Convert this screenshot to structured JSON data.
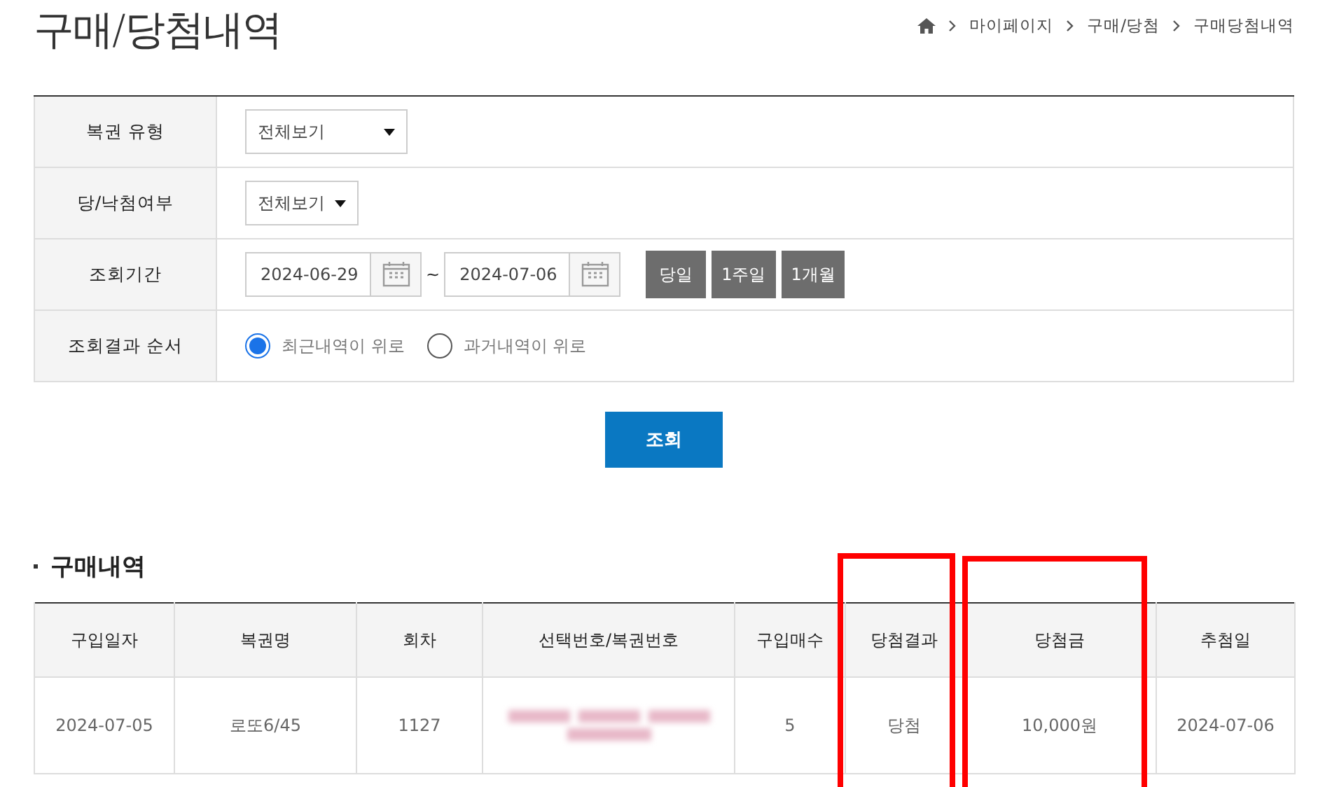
{
  "page_title": "구매/당첨내역",
  "breadcrumb": [
    "마이페이지",
    "구매/당첨",
    "구매당첨내역"
  ],
  "search_form": {
    "rows": [
      {
        "kind": "select",
        "label": "복권 유형",
        "value": "전체보기",
        "wide": true
      },
      {
        "kind": "select",
        "label": "당/낙첨여부",
        "value": "전체보기",
        "wide": false
      },
      {
        "kind": "period",
        "label": "조회기간",
        "from": "2024-06-29",
        "separator": "~",
        "to": "2024-07-06",
        "buttons": [
          "당일",
          "1주일",
          "1개월"
        ]
      },
      {
        "kind": "radio",
        "label": "조회결과 순서",
        "options": [
          {
            "label": "최근내역이 위로",
            "selected": true
          },
          {
            "label": "과거내역이 위로",
            "selected": false
          }
        ]
      }
    ]
  },
  "search_button": "조회",
  "section_title": "구매내역",
  "table": {
    "columns": [
      "구입일자",
      "복권명",
      "회차",
      "선택번호/복권번호",
      "구입매수",
      "당첨결과",
      "당첨금",
      "추첨일"
    ],
    "rows": [
      {
        "cells": [
          "2024-07-05",
          "로또6/45",
          "1127",
          null,
          "5",
          "당첨",
          "10,000원",
          "2024-07-06"
        ]
      }
    ]
  }
}
